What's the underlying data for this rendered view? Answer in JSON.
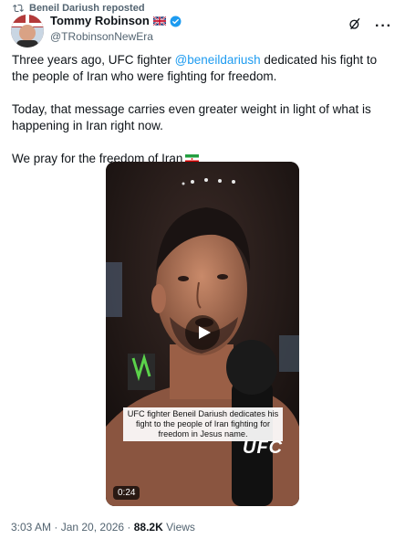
{
  "repost": {
    "label": "Beneil Dariush reposted",
    "icon": "repost-icon"
  },
  "author": {
    "name": "Tommy Robinson",
    "flag": "uk-flag",
    "verified": true,
    "handle": "@TRobinsonNewEra"
  },
  "actions": {
    "grok": "grok-icon",
    "more": "···"
  },
  "tweet": {
    "p1_before": "Three years ago, UFC fighter ",
    "mention": "@beneildariush",
    "p1_after": " dedicated his fight to the people of Iran who were fighting for freedom.",
    "p2": "Today, that message carries even greater weight in light of what is happening in Iran right now.",
    "p3": "We pray for the freedom of Iran"
  },
  "video": {
    "caption": "UFC fighter Beneil Dariush dedicates his fight to the people of Iran fighting for freedom in Jesus name.",
    "mic_logo": "UFC",
    "duration": "0:24"
  },
  "meta": {
    "time": "3:03 AM · Jan 20, 2026 · ",
    "views_count": "88.2K",
    "views_label": " Views"
  },
  "colors": {
    "link": "#1d9bf0",
    "verified": "#1d9bf0",
    "muted": "#536471"
  }
}
